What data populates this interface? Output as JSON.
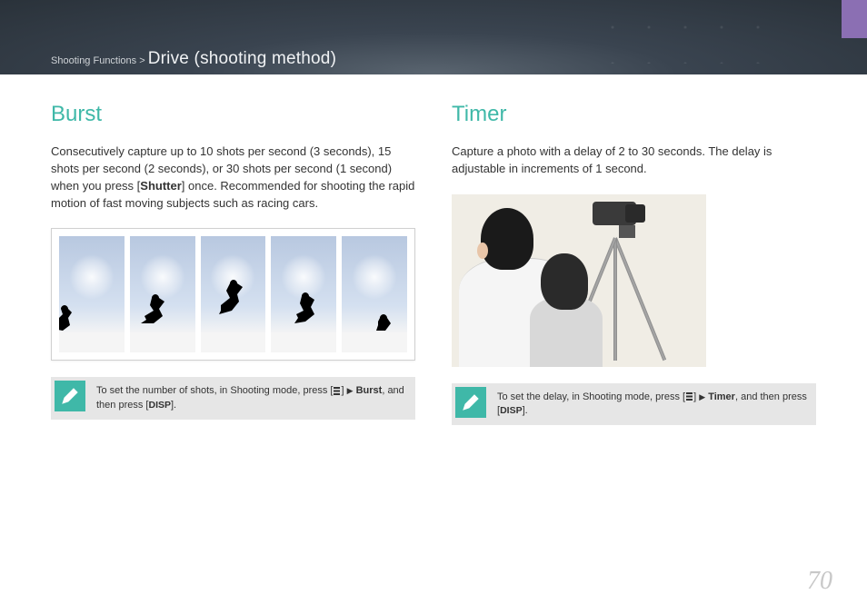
{
  "breadcrumb": {
    "parent": "Shooting Functions",
    "separator": ">",
    "title": "Drive (shooting method)"
  },
  "sections": {
    "burst": {
      "title": "Burst",
      "desc_part1": "Consecutively capture up to 10 shots per second (3 seconds), 15 shots per second (2 seconds), or 30 shots per second (1 second) when you press [",
      "desc_bold1": "Shutter",
      "desc_part2": "] once. Recommended for shooting the rapid motion of fast moving subjects such as racing cars.",
      "tip_part1": "To set the number of shots, in Shooting mode, press [",
      "tip_arrow": "▶",
      "tip_bold": "Burst",
      "tip_part2": ", and then press [",
      "tip_disp": "DISP",
      "tip_end": "]."
    },
    "timer": {
      "title": "Timer",
      "desc": "Capture a photo with a delay of 2 to 30 seconds. The delay is adjustable in increments of 1 second.",
      "tip_part1": "To set the delay, in Shooting mode, press [",
      "tip_arrow": "▶",
      "tip_bold": "Timer",
      "tip_part2": ", and then press [",
      "tip_disp": "DISP",
      "tip_end": "]."
    }
  },
  "page_number": "70"
}
